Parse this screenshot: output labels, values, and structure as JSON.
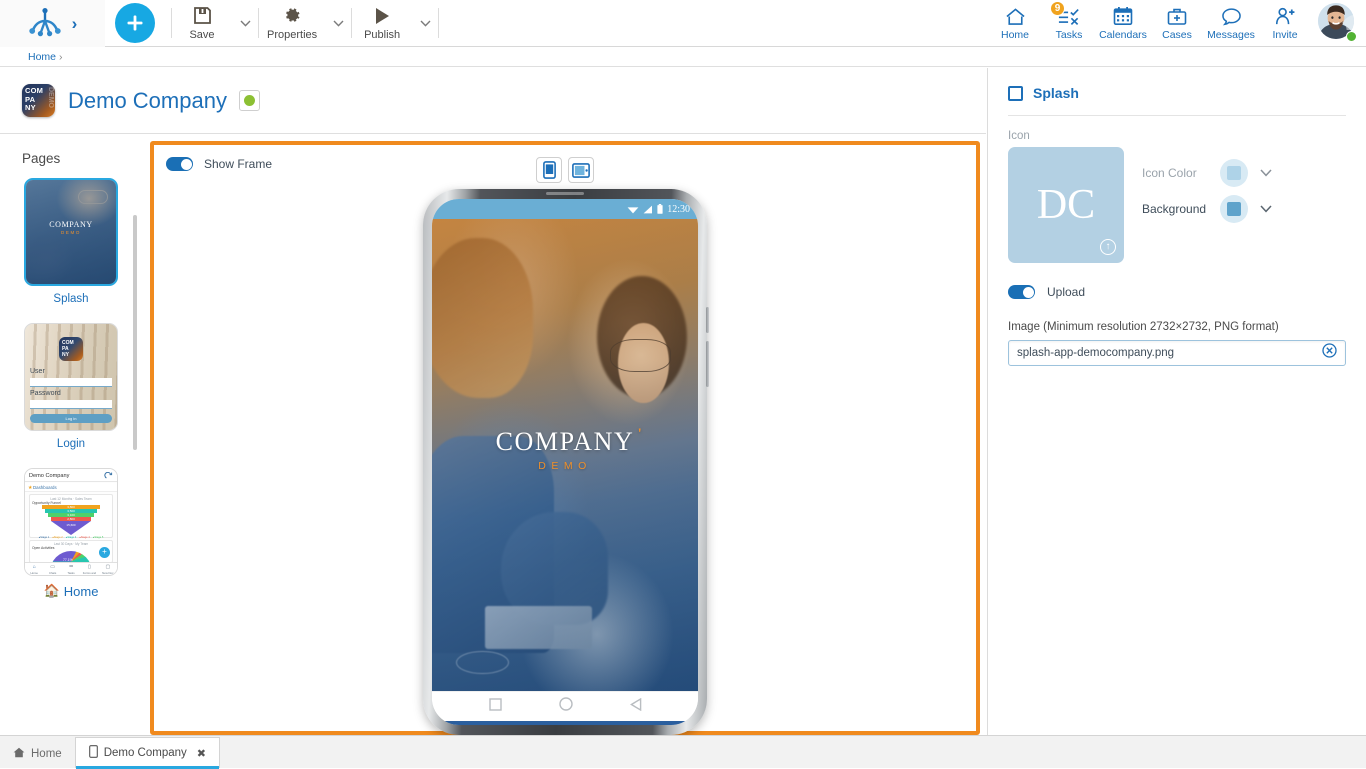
{
  "toolbar": {
    "logo_icon": "frog-logo",
    "expand_icon": "chevron-right-icon",
    "add_label": "+",
    "items": [
      {
        "label": "Save",
        "icon": "save-floppy-icon"
      },
      {
        "label": "Properties",
        "icon": "gear-icon"
      },
      {
        "label": "Publish",
        "icon": "play-triangle-icon"
      }
    ],
    "nav": [
      {
        "label": "Home",
        "icon": "home-icon",
        "badge": ""
      },
      {
        "label": "Tasks",
        "icon": "tasks-checklist-icon",
        "badge": "9"
      },
      {
        "label": "Calendars",
        "icon": "calendar-icon",
        "badge": ""
      },
      {
        "label": "Cases",
        "icon": "briefcase-icon",
        "badge": ""
      },
      {
        "label": "Messages",
        "icon": "speech-bubble-icon",
        "badge": ""
      },
      {
        "label": "Invite",
        "icon": "person-add-icon",
        "badge": ""
      }
    ],
    "avatar": {
      "name": "avatar",
      "status": "online"
    }
  },
  "breadcrumb": {
    "root": "Home",
    "separator": "›"
  },
  "page_header": {
    "app_icon_text": "COM\nPA\nNY",
    "app_icon_ghost": "DEMO",
    "title": "Demo Company",
    "status": "active"
  },
  "sidebar": {
    "title": "Pages",
    "items": [
      {
        "label": "Splash",
        "selected": true,
        "icon": ""
      },
      {
        "label": "Login",
        "selected": false,
        "icon": ""
      },
      {
        "label": "Home",
        "selected": false,
        "icon": "home-icon"
      }
    ],
    "thumb_login": {
      "icon_text": "COM\nPA\nNY",
      "user_label": "User",
      "password_label": "Password",
      "button_label": "Log in"
    },
    "thumb_home": {
      "header": "Demo Company",
      "refresh_icon": "refresh-icon",
      "sub": "Dashboards",
      "star_icon": "star-icon",
      "chart1_title": "Opportunity Funnel",
      "chart1_meta": "Last 12 Months · Sales Team",
      "funnel_values": [
        "3,800",
        "3,500",
        "3,100",
        "2,800",
        "15,600"
      ],
      "legend": [
        "Stage 1",
        "Stage 2",
        "Stage 3",
        "Stage 4",
        "Stage 5",
        "Stage 6"
      ],
      "chart2_title": "Open Activities",
      "chart2_meta": "Last 30 Days · My Team",
      "pie_label": "77.1%",
      "fab_icon": "plus-icon",
      "nav": [
        "Home",
        "Chats",
        "Tasks",
        "Forms and",
        "New Doc"
      ]
    }
  },
  "preview": {
    "show_frame_label": "Show Frame",
    "show_frame_on": true,
    "device_buttons": [
      {
        "icon": "phone-portrait-icon",
        "selected": true
      },
      {
        "icon": "tablet-landscape-icon",
        "selected": false
      }
    ],
    "phone": {
      "status_bar": {
        "wifi_icon": "wifi-icon",
        "signal_icon": "signal-icon",
        "battery_icon": "battery-icon",
        "time": "12:30"
      },
      "splash": {
        "brand": "COMPANY",
        "brand_tick": "'",
        "sub_brand": "DEMO"
      },
      "nav_buttons": [
        {
          "icon": "square-recents-icon"
        },
        {
          "icon": "circle-home-icon"
        },
        {
          "icon": "triangle-back-icon"
        }
      ]
    }
  },
  "properties": {
    "header_title": "Splash",
    "header_checkbox_checked": false,
    "icon_field_label": "Icon",
    "icon_initials": "DC",
    "icon_upload_glyph": "↑",
    "icon_color_label": "Icon Color",
    "icon_color_value": "#aed3e8",
    "background_label": "Background",
    "background_value": "#5fa3cb",
    "caret_icon": "chevron-down-icon",
    "upload_toggle_label": "Upload",
    "upload_toggle_on": true,
    "image_label": "Image (Minimum resolution 2732×2732, PNG format)",
    "image_filename": "splash-app-democompany.png",
    "clear_icon": "circle-x-icon"
  },
  "taskbar": {
    "tabs": [
      {
        "label": "Home",
        "icon": "home-icon",
        "active": false,
        "closable": false
      },
      {
        "label": "Demo Company",
        "icon": "mobile-icon",
        "active": true,
        "closable": true,
        "close_glyph": "✖"
      }
    ]
  },
  "colors": {
    "accent_blue": "#1d6fb8",
    "cyan": "#17a8e3",
    "orange_border": "#f08a1e",
    "badge_orange": "#f0a31e",
    "status_green": "#8cc033",
    "brand_orange": "#f0902a"
  }
}
